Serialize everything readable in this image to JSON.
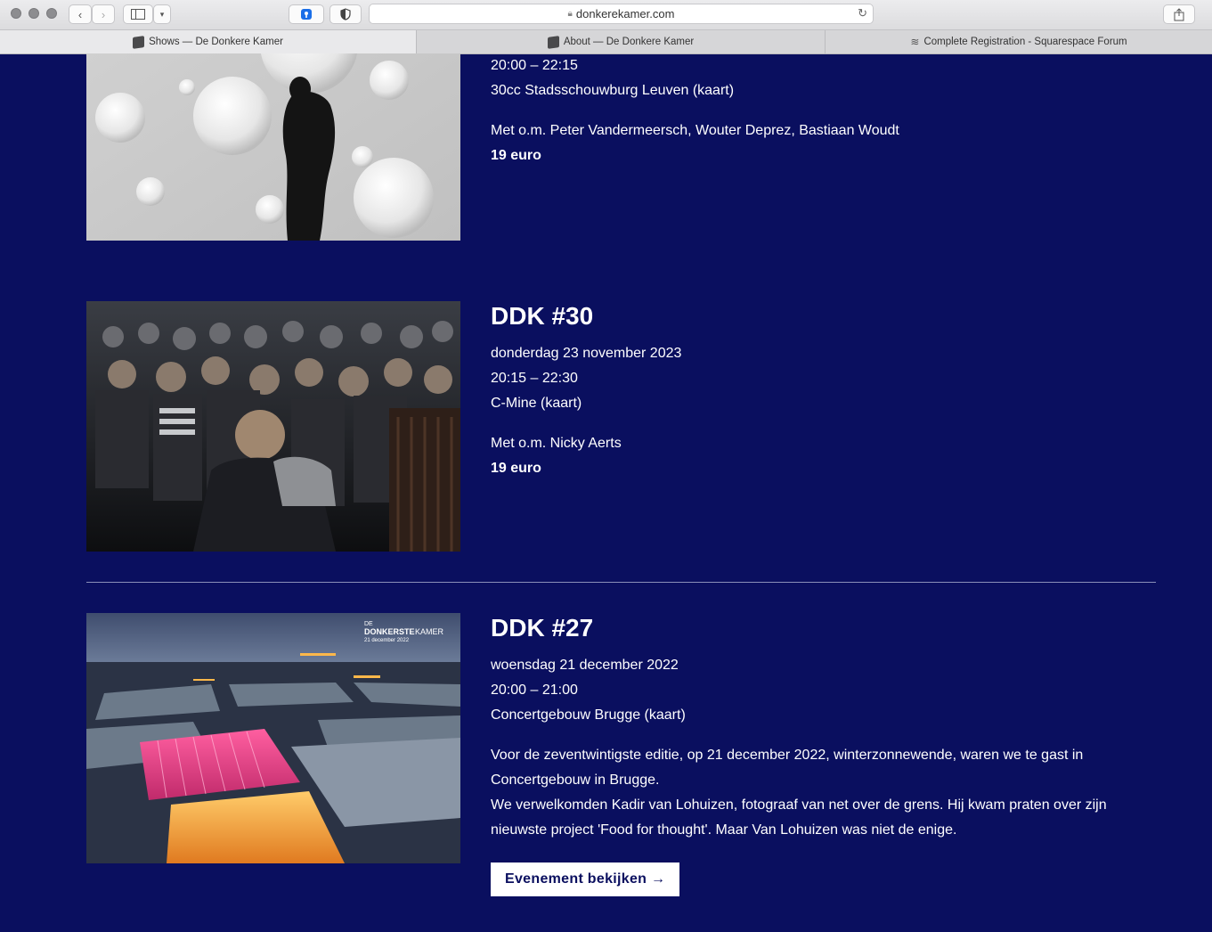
{
  "browser": {
    "url": "donkerekamer.com",
    "tabs": [
      {
        "title": "Shows — De Donkere Kamer",
        "active": true
      },
      {
        "title": "About — De Donkere Kamer",
        "active": false
      },
      {
        "title": "Complete Registration - Squarespace Forum",
        "active": false
      }
    ]
  },
  "events": [
    {
      "time": "20:00 – 22:15",
      "venue": "30cc Stadsschouwburg Leuven (kaart)",
      "guests": "Met o.m. Peter Vandermeersch, Wouter Deprez, Bastiaan Woudt",
      "price": "19 euro"
    },
    {
      "title": "DDK #30",
      "date": "donderdag 23 november 2023",
      "time": "20:15 – 22:30",
      "venue": "C-Mine (kaart)",
      "guests": "Met o.m. Nicky Aerts",
      "price": "19 euro"
    },
    {
      "title": "DDK #27",
      "date": "woensdag 21 december 2022",
      "time": "20:00 – 21:00",
      "venue": "Concertgebouw Brugge (kaart)",
      "description_1": "Voor de zeventwintigste editie, op 21 december 2022, winterzonnewende, waren we te gast in",
      "description_2": "Concertgebouw in Brugge.",
      "description_3": "We verwelkomden Kadir van Lohuizen, fotograaf van net over de grens. Hij kwam praten over zijn",
      "description_4": "nieuwste project 'Food for thought'. Maar Van Lohuizen was niet de enige.",
      "button_label": "Evenement bekijken →",
      "image_logo_de": "DE",
      "image_logo_main": "DONKERSTE",
      "image_logo_kamer": "KAMER",
      "image_logo_date": "21 december 2022"
    }
  ]
}
